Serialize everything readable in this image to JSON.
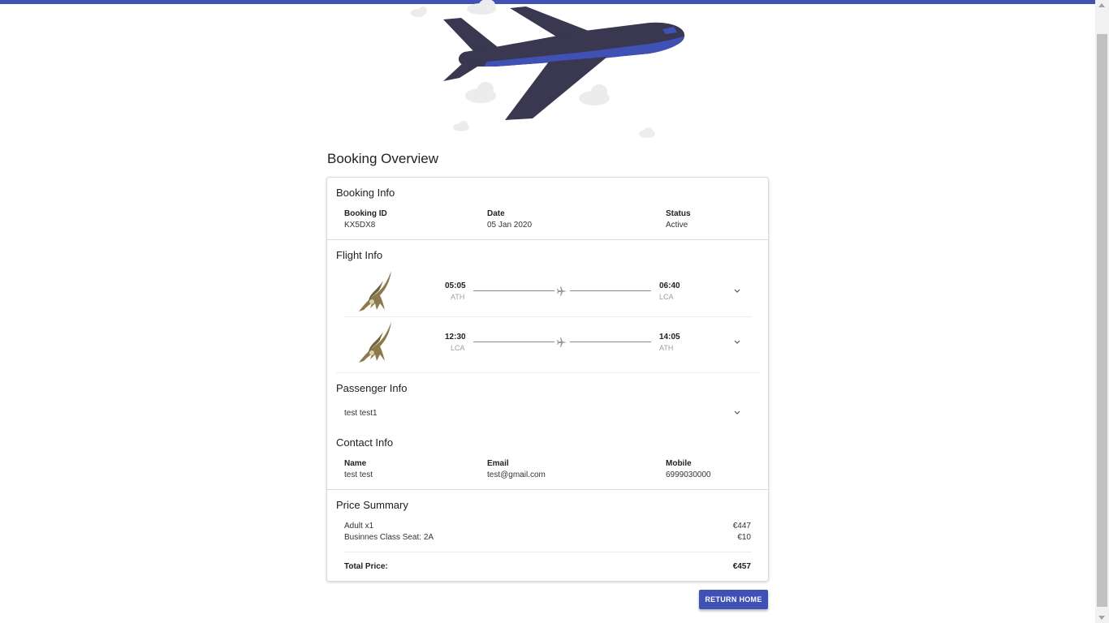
{
  "page": {
    "title": "Booking Overview",
    "accent_color": "#3f51b5"
  },
  "booking_info": {
    "title": "Booking Info",
    "booking_id_label": "Booking ID",
    "booking_id": "KX5DX8",
    "date_label": "Date",
    "date": "05 Jan 2020",
    "status_label": "Status",
    "status": "Active"
  },
  "flight_info": {
    "title": "Flight Info",
    "flights": [
      {
        "dep_time": "05:05",
        "dep_code": "ATH",
        "arr_time": "06:40",
        "arr_code": "LCA"
      },
      {
        "dep_time": "12:30",
        "dep_code": "LCA",
        "arr_time": "14:05",
        "arr_code": "ATH"
      }
    ]
  },
  "passenger_info": {
    "title": "Passenger Info",
    "passengers": [
      "test test1"
    ]
  },
  "contact_info": {
    "title": "Contact Info",
    "name_label": "Name",
    "name": "test test",
    "email_label": "Email",
    "email": "test@gmail.com",
    "mobile_label": "Mobile",
    "mobile": "6999030000"
  },
  "price_summary": {
    "title": "Price Summary",
    "items": [
      {
        "label": "Adult x1",
        "amount": "€447"
      },
      {
        "label": "Businnes Class Seat: 2A",
        "amount": "€10"
      }
    ],
    "total_label": "Total Price:",
    "total_amount": "€457"
  },
  "actions": {
    "return_home_label": "RETURN HOME"
  },
  "icons": {
    "plane": "airplane-illustration",
    "logo": "airline-eagle-logo",
    "route": "airplane-icon",
    "expand": "chevron-down-icon"
  }
}
